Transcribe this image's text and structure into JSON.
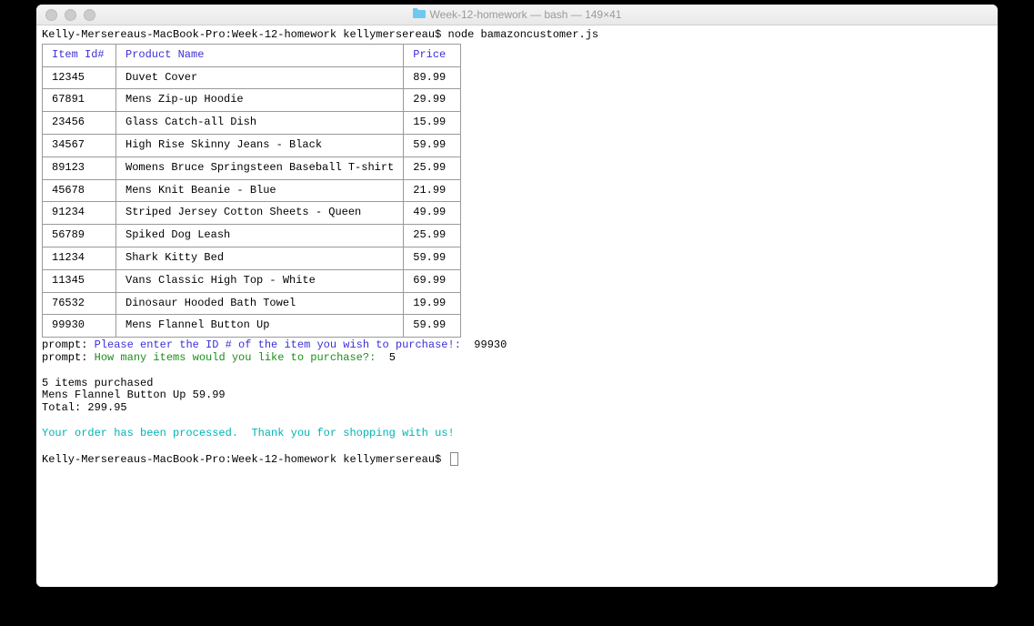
{
  "titlebar": {
    "folder": "Week-12-homework",
    "process": "bash",
    "dims": "149×41"
  },
  "prompt": {
    "host": "Kelly-Mersereaus-MacBook-Pro",
    "dir": "Week-12-homework",
    "user": "kellymersereau",
    "symbol": "$"
  },
  "cmd1": "node bamazoncustomer.js",
  "table": {
    "headers": {
      "id": "Item Id#",
      "name": "Product Name",
      "price": "Price"
    },
    "rows": [
      {
        "id": "12345",
        "name": "Duvet Cover",
        "price": "89.99"
      },
      {
        "id": "67891",
        "name": "Mens Zip-up Hoodie",
        "price": "29.99"
      },
      {
        "id": "23456",
        "name": "Glass Catch-all Dish",
        "price": "15.99"
      },
      {
        "id": "34567",
        "name": "High Rise Skinny Jeans - Black",
        "price": "59.99"
      },
      {
        "id": "89123",
        "name": "Womens Bruce Springsteen Baseball T-shirt",
        "price": "25.99"
      },
      {
        "id": "45678",
        "name": "Mens Knit Beanie - Blue",
        "price": "21.99"
      },
      {
        "id": "91234",
        "name": "Striped Jersey Cotton Sheets - Queen",
        "price": "49.99"
      },
      {
        "id": "56789",
        "name": "Spiked Dog Leash",
        "price": "25.99"
      },
      {
        "id": "11234",
        "name": "Shark Kitty Bed",
        "price": "59.99"
      },
      {
        "id": "11345",
        "name": "Vans Classic High Top - White",
        "price": "69.99"
      },
      {
        "id": "76532",
        "name": "Dinosaur Hooded Bath Towel",
        "price": "19.99"
      },
      {
        "id": "99930",
        "name": "Mens Flannel Button Up",
        "price": "59.99"
      }
    ]
  },
  "prompts": {
    "label": "prompt:",
    "q1": "Please enter the ID # of the item you wish to purchase!:",
    "a1": "99930",
    "q2": "How many items would you like to purchase?:",
    "a2": "5"
  },
  "result": {
    "line1": "5 items purchased",
    "line2": "Mens Flannel Button Up 59.99",
    "line3": "Total: 299.95"
  },
  "thanks": "Your order has been processed.  Thank you for shopping with us!"
}
